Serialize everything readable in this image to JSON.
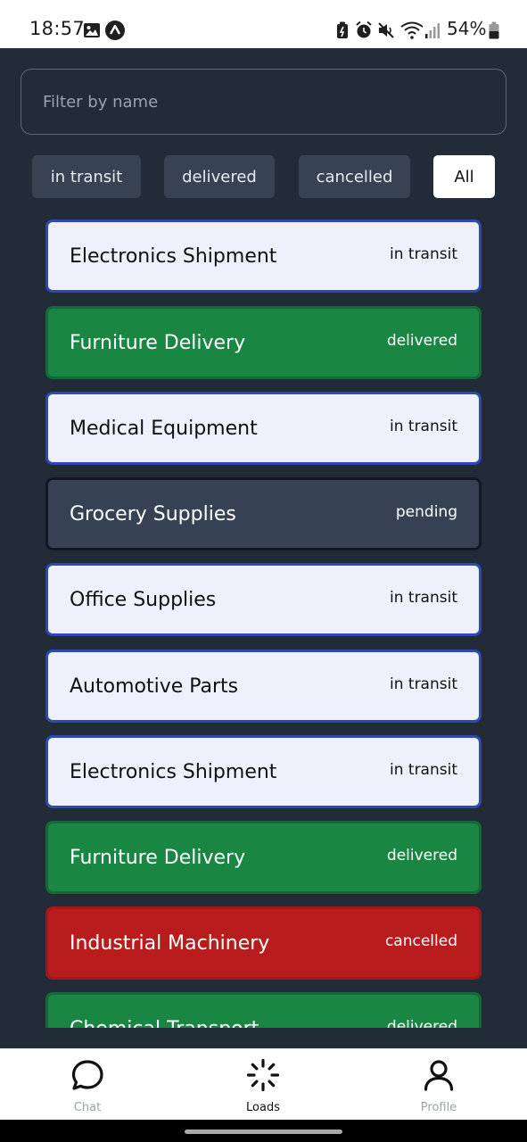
{
  "status_bar": {
    "time": "18:57",
    "battery_percent": "54%",
    "left_icons": [
      "gallery-icon",
      "app-a-icon"
    ],
    "right_icons": [
      "battery-saver-icon",
      "alarm-icon",
      "mute-icon",
      "wifi-icon",
      "signal-icon",
      "battery-icon"
    ]
  },
  "search": {
    "placeholder": "Filter by name",
    "value": ""
  },
  "filters": [
    {
      "label": "in transit",
      "active": false
    },
    {
      "label": "delivered",
      "active": false
    },
    {
      "label": "cancelled",
      "active": false
    },
    {
      "label": "All",
      "active": true
    }
  ],
  "loads": [
    {
      "name": "Electronics Shipment",
      "status": "in transit"
    },
    {
      "name": "Furniture Delivery",
      "status": "delivered"
    },
    {
      "name": "Medical Equipment",
      "status": "in transit"
    },
    {
      "name": "Grocery Supplies",
      "status": "pending"
    },
    {
      "name": "Office Supplies",
      "status": "in transit"
    },
    {
      "name": "Automotive Parts",
      "status": "in transit"
    },
    {
      "name": "Electronics Shipment",
      "status": "in transit"
    },
    {
      "name": "Furniture Delivery",
      "status": "delivered"
    },
    {
      "name": "Industrial Machinery",
      "status": "cancelled"
    },
    {
      "name": "Chemical Transport",
      "status": "delivered"
    }
  ],
  "status_colors": {
    "in transit": "#eef1fc",
    "delivered": "#198643",
    "pending": "#364254",
    "cancelled": "#b91c1c"
  },
  "nav": {
    "items": [
      {
        "label": "Chat",
        "icon": "chat-bubble-icon",
        "active": false
      },
      {
        "label": "Loads",
        "icon": "loader-icon",
        "active": true
      },
      {
        "label": "Profile",
        "icon": "user-icon",
        "active": false
      }
    ]
  }
}
